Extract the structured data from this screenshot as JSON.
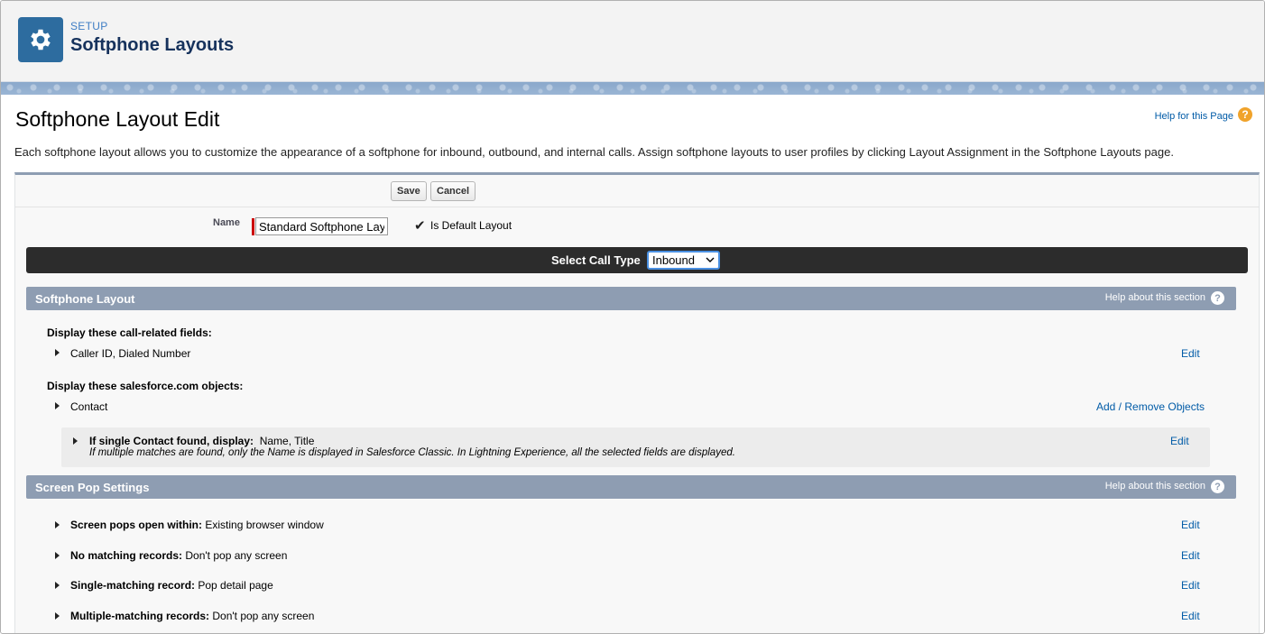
{
  "header": {
    "eyebrow": "SETUP",
    "title": "Softphone Layouts",
    "icon": "gear-icon"
  },
  "page": {
    "title": "Softphone Layout Edit",
    "help_link": "Help for this Page",
    "description": "Each softphone layout allows you to customize the appearance of a softphone for inbound, outbound, and internal calls. Assign softphone layouts to user profiles by clicking Layout Assignment in the Softphone Layouts page."
  },
  "toolbar": {
    "save_label": "Save",
    "cancel_label": "Cancel"
  },
  "form": {
    "name_label": "Name",
    "name_value": "Standard Softphone Layout",
    "default_label": "Is Default Layout",
    "default_checked": true
  },
  "call_type": {
    "label": "Select Call Type",
    "selected": "Inbound"
  },
  "softphone_section": {
    "title": "Softphone Layout",
    "help": "Help about this section",
    "call_fields_label": "Display these call-related fields:",
    "call_fields_value": "Caller ID, Dialed Number",
    "edit_label": "Edit",
    "objects_label": "Display these salesforce.com objects:",
    "object_name": "Contact",
    "add_remove_label": "Add / Remove Objects",
    "single_found_label": "If single Contact found, display:",
    "single_found_value": "Name, Title",
    "multi_note": "If multiple matches are found, only the Name is displayed in Salesforce Classic. In Lightning Experience, all the selected fields are displayed."
  },
  "screen_pop_section": {
    "title": "Screen Pop Settings",
    "help": "Help about this section",
    "rows": [
      {
        "label": "Screen pops open within:",
        "value": "Existing browser window",
        "edit": "Edit"
      },
      {
        "label": "No matching records:",
        "value": "Don't pop any screen",
        "edit": "Edit"
      },
      {
        "label": "Single-matching record:",
        "value": "Pop detail page",
        "edit": "Edit"
      },
      {
        "label": "Multiple-matching records:",
        "value": "Don't pop any screen",
        "edit": "Edit"
      }
    ]
  },
  "colors": {
    "accent": "#2d6c9f",
    "section": "#8e9db2",
    "link": "#015ba7",
    "call_bar": "#2c2c2c"
  }
}
